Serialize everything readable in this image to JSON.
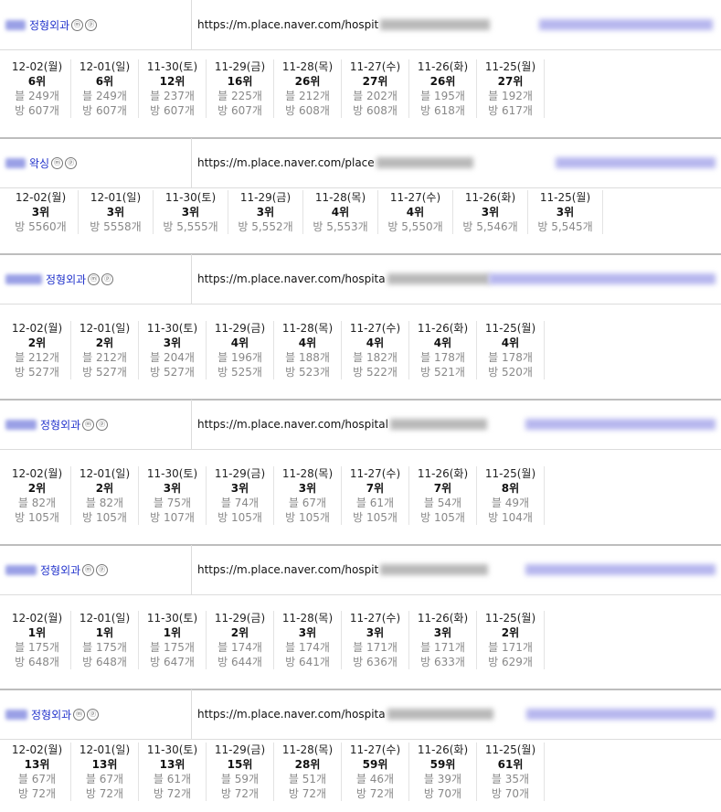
{
  "groups": [
    {
      "name": "정형외과",
      "url": "https://m.place.naver.com/hospit",
      "days": [
        {
          "date": "12-02(월)",
          "rank": "6위",
          "blog": "블 249개",
          "bang": "방 607개"
        },
        {
          "date": "12-01(일)",
          "rank": "6위",
          "blog": "블 249개",
          "bang": "방 607개"
        },
        {
          "date": "11-30(토)",
          "rank": "12위",
          "blog": "블 237개",
          "bang": "방 607개"
        },
        {
          "date": "11-29(금)",
          "rank": "16위",
          "blog": "블 225개",
          "bang": "방 607개"
        },
        {
          "date": "11-28(목)",
          "rank": "26위",
          "blog": "블 212개",
          "bang": "방 608개"
        },
        {
          "date": "11-27(수)",
          "rank": "27위",
          "blog": "블 202개",
          "bang": "방 608개"
        },
        {
          "date": "11-26(화)",
          "rank": "26위",
          "blog": "블 195개",
          "bang": "방 618개"
        },
        {
          "date": "11-25(월)",
          "rank": "27위",
          "blog": "블 192개",
          "bang": "방 617개"
        }
      ]
    },
    {
      "name": "왁싱",
      "url": "https://m.place.naver.com/place",
      "days": [
        {
          "date": "12-02(월)",
          "rank": "3위",
          "bang": "방 5560개"
        },
        {
          "date": "12-01(일)",
          "rank": "3위",
          "bang": "방 5558개"
        },
        {
          "date": "11-30(토)",
          "rank": "3위",
          "bang": "방 5,555개"
        },
        {
          "date": "11-29(금)",
          "rank": "3위",
          "bang": "방 5,552개"
        },
        {
          "date": "11-28(목)",
          "rank": "4위",
          "bang": "방 5,553개"
        },
        {
          "date": "11-27(수)",
          "rank": "4위",
          "bang": "방 5,550개"
        },
        {
          "date": "11-26(화)",
          "rank": "3위",
          "bang": "방 5,546개"
        },
        {
          "date": "11-25(월)",
          "rank": "3위",
          "bang": "방 5,545개"
        }
      ]
    },
    {
      "name": "정형외과",
      "url": "https://m.place.naver.com/hospita",
      "days": [
        {
          "date": "12-02(월)",
          "rank": "2위",
          "blog": "블 212개",
          "bang": "방 527개"
        },
        {
          "date": "12-01(일)",
          "rank": "2위",
          "blog": "블 212개",
          "bang": "방 527개"
        },
        {
          "date": "11-30(토)",
          "rank": "3위",
          "blog": "블 204개",
          "bang": "방 527개"
        },
        {
          "date": "11-29(금)",
          "rank": "4위",
          "blog": "블 196개",
          "bang": "방 525개"
        },
        {
          "date": "11-28(목)",
          "rank": "4위",
          "blog": "블 188개",
          "bang": "방 523개"
        },
        {
          "date": "11-27(수)",
          "rank": "4위",
          "blog": "블 182개",
          "bang": "방 522개"
        },
        {
          "date": "11-26(화)",
          "rank": "4위",
          "blog": "블 178개",
          "bang": "방 521개"
        },
        {
          "date": "11-25(월)",
          "rank": "4위",
          "blog": "블 178개",
          "bang": "방 520개"
        }
      ]
    },
    {
      "name": "정형외과",
      "url": "https://m.place.naver.com/hospital",
      "days": [
        {
          "date": "12-02(월)",
          "rank": "2위",
          "blog": "블 82개",
          "bang": "방 105개"
        },
        {
          "date": "12-01(일)",
          "rank": "2위",
          "blog": "블 82개",
          "bang": "방 105개"
        },
        {
          "date": "11-30(토)",
          "rank": "3위",
          "blog": "블 75개",
          "bang": "방 107개"
        },
        {
          "date": "11-29(금)",
          "rank": "3위",
          "blog": "블 74개",
          "bang": "방 105개"
        },
        {
          "date": "11-28(목)",
          "rank": "3위",
          "blog": "블 67개",
          "bang": "방 105개"
        },
        {
          "date": "11-27(수)",
          "rank": "7위",
          "blog": "블 61개",
          "bang": "방 105개"
        },
        {
          "date": "11-26(화)",
          "rank": "7위",
          "blog": "블 54개",
          "bang": "방 105개"
        },
        {
          "date": "11-25(월)",
          "rank": "8위",
          "blog": "블 49개",
          "bang": "방 104개"
        }
      ]
    },
    {
      "name": "정형외과",
      "url": "https://m.place.naver.com/hospit",
      "days": [
        {
          "date": "12-02(월)",
          "rank": "1위",
          "blog": "블 175개",
          "bang": "방 648개"
        },
        {
          "date": "12-01(일)",
          "rank": "1위",
          "blog": "블 175개",
          "bang": "방 648개"
        },
        {
          "date": "11-30(토)",
          "rank": "1위",
          "blog": "블 175개",
          "bang": "방 647개"
        },
        {
          "date": "11-29(금)",
          "rank": "2위",
          "blog": "블 174개",
          "bang": "방 644개"
        },
        {
          "date": "11-28(목)",
          "rank": "3위",
          "blog": "블 174개",
          "bang": "방 641개"
        },
        {
          "date": "11-27(수)",
          "rank": "3위",
          "blog": "블 171개",
          "bang": "방 636개"
        },
        {
          "date": "11-26(화)",
          "rank": "3위",
          "blog": "블 171개",
          "bang": "방 633개"
        },
        {
          "date": "11-25(월)",
          "rank": "2위",
          "blog": "블 171개",
          "bang": "방 629개"
        }
      ]
    },
    {
      "name": "정형외과",
      "url": "https://m.place.naver.com/hospita",
      "days": [
        {
          "date": "12-02(월)",
          "rank": "13위",
          "blog": "블 67개",
          "bang": "방 72개"
        },
        {
          "date": "12-01(일)",
          "rank": "13위",
          "blog": "블 67개",
          "bang": "방 72개"
        },
        {
          "date": "11-30(토)",
          "rank": "13위",
          "blog": "블 61개",
          "bang": "방 72개"
        },
        {
          "date": "11-29(금)",
          "rank": "15위",
          "blog": "블 59개",
          "bang": "방 72개"
        },
        {
          "date": "11-28(목)",
          "rank": "28위",
          "blog": "블 51개",
          "bang": "방 72개"
        },
        {
          "date": "11-27(수)",
          "rank": "59위",
          "blog": "블 46개",
          "bang": "방 72개"
        },
        {
          "date": "11-26(화)",
          "rank": "59위",
          "blog": "블 39개",
          "bang": "방 70개"
        },
        {
          "date": "11-25(월)",
          "rank": "61위",
          "blog": "블 35개",
          "bang": "방 70개"
        }
      ]
    }
  ],
  "badge_m": "ⓜ",
  "badge_p": "ⓟ"
}
